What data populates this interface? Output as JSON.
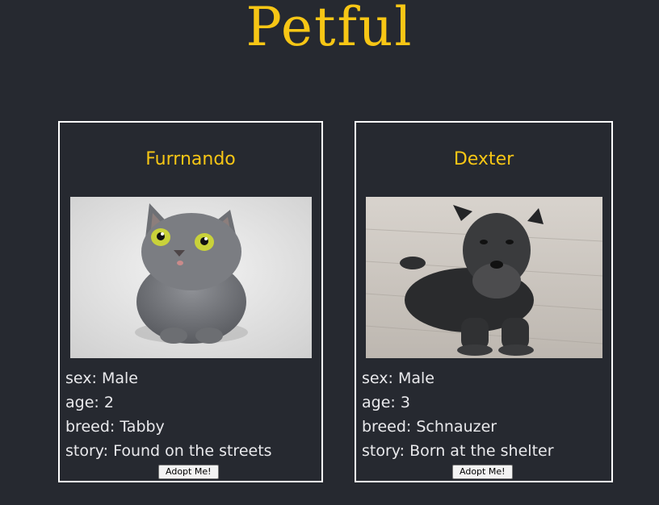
{
  "app": {
    "title": "Petful"
  },
  "pets": [
    {
      "name": "Furrnando",
      "image": "gray-cat-photo",
      "sex": "sex: Male",
      "age": "age: 2",
      "breed": "breed: Tabby",
      "story": "story: Found on the streets",
      "button_label": "Adopt Me!"
    },
    {
      "name": "Dexter",
      "image": "black-schnauzer-photo",
      "sex": "sex: Male",
      "age": "age: 3",
      "breed": "breed: Schnauzer",
      "story": "story: Born at the shelter",
      "button_label": "Adopt Me!"
    }
  ],
  "colors": {
    "background": "#262930",
    "accent": "#f7c615",
    "text": "#e9e9ec",
    "card_border": "#ffffff"
  }
}
